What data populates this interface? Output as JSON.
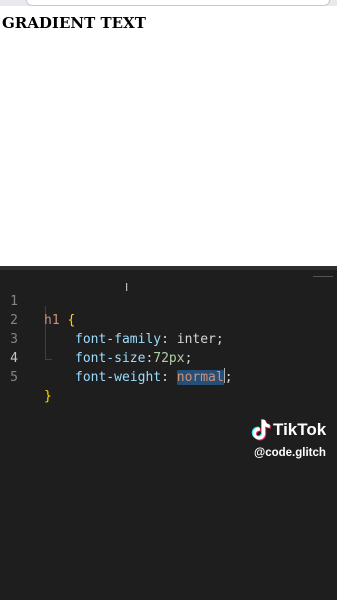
{
  "preview": {
    "heading": "GRADIENT TEXT"
  },
  "editor": {
    "lines": [
      {
        "number": "1",
        "selector": "h1",
        "brace": "{"
      },
      {
        "number": "2",
        "property": "font-family",
        "value": "inter"
      },
      {
        "number": "3",
        "property": "font-size",
        "value": "72px"
      },
      {
        "number": "4",
        "property": "font-weight",
        "value": "normal"
      },
      {
        "number": "5",
        "brace": "}"
      }
    ],
    "active_line": "4"
  },
  "watermark": {
    "brand": "TikTok",
    "handle": "@code.glitch"
  },
  "colors": {
    "editor_bg": "#1e1e1e",
    "selector": "#ce9178",
    "brace": "#ffd700",
    "property": "#9cdcfe",
    "selection": "#264f78"
  }
}
